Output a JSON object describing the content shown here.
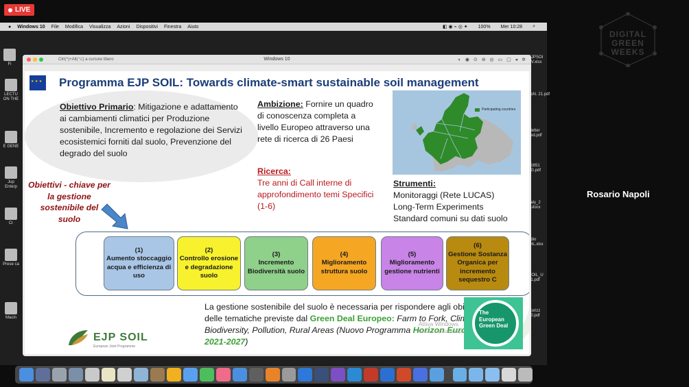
{
  "stream": {
    "live_label": "LIVE",
    "speaker_name": "Rosario Napoli",
    "watermark_lines": [
      "DIGITAL",
      "GREEN",
      "WEEKS"
    ]
  },
  "mac_menubar": {
    "items": [
      "Windows 10",
      "File",
      "Modifica",
      "Visualizza",
      "Azioni",
      "Dispositivi",
      "Finestra",
      "Aiuto"
    ],
    "battery": "100%",
    "clock": "Mer 10:28"
  },
  "desktop": {
    "left_labels": [
      "Fi",
      "LECTU ON THE",
      "E GENE",
      "Jup Enterp",
      "Cr",
      "Prese ca",
      "Macin"
    ],
    "right_labels": [
      "EJPSOI SV.xlsx",
      "doN. 21.pdf",
      "_letter ked.pdf",
      "21651 7G.pdf",
      "Italy_2 4.docx",
      "edio OIL.xlsx",
      "COIL_U 21.pdf",
      "storizz 10.pdf"
    ]
  },
  "vm_window": {
    "title": "Windows 10",
    "hint": "Ctrl(^)+Alt(⌥) a cursore libero"
  },
  "slide": {
    "title": "Programma EJP SOIL: Towards climate-smart sustainable soil management",
    "objective_label": "Obiettivo Primario",
    "objective_text": ": Mitigazione e adattamento ai cambiamenti climatici per Produzione sostenibile, Incremento e regolazione dei Servizi ecosistemici forniti dal suolo, Prevenzione del degrado del suolo",
    "ambition_label": "Ambizione:",
    "ambition_text": " Fornire un quadro di conoscenza completa a livello Europeo attraverso una rete di ricerca di 26 Paesi",
    "research_label": "Ricerca:",
    "research_text": "Tre anni di Call interne di approfondimento temi Specifici (1-6)",
    "map_legend": "Participating countries",
    "tools_label": "Strumenti:",
    "tools": [
      "Monitoraggi (Rete LUCAS)",
      "Long-Term Experiments",
      "Standard comuni su dati suolo"
    ],
    "key_objectives": "Obiettivi - chiave per la gestione sostenibile del suolo",
    "boxes": [
      {
        "num": "(1)",
        "text": "Aumento stoccaggio acqua e efficienza di uso",
        "color": "#a9c6e6"
      },
      {
        "num": "(2)",
        "text": "Controllo erosione e degradazione suolo",
        "color": "#f7f22d"
      },
      {
        "num": "(3)",
        "text": "Incremento Biodiversità suolo",
        "color": "#8fd08a"
      },
      {
        "num": "(4)",
        "text": "Miglioramento struttura suolo",
        "color": "#f5a623"
      },
      {
        "num": "(5)",
        "text": "Miglioramento gestione nutrienti",
        "color": "#c884e6"
      },
      {
        "num": "(6)",
        "text": "Gestione Sostanza Organica per incremento sequestro C",
        "color": "#b88a10"
      }
    ],
    "bottom_text_a": "La gestione sostenibile del suolo è necessaria per rispondere agli obiettivi delle tematiche previste dal ",
    "green_deal": "Green Deal Europeo:",
    "bottom_text_b": " Farm to Fork, Climate, Biodiversity, Pollution, Rural Areas",
    "bottom_text_c": " (Nuovo Programma ",
    "horizon": "Horizon Europe 2021-2027",
    "bottom_text_d": ")",
    "logo_name": "EJP SOIL",
    "logo_sub": "European Joint Programme",
    "green_deal_badge": "The European Green Deal",
    "activate_title": "Attiva Windows",
    "activate_sub": "Passa a Impostazioni per"
  },
  "dock_colors": [
    "#4a8fe0",
    "#5e6f9a",
    "#9aa3ad",
    "#7a8fa8",
    "#c9c9c9",
    "#e9e4c4",
    "#d0d0d0",
    "#8fb5d6",
    "#9a7a50",
    "#f0b020",
    "#5aa0f0",
    "#4cbf5c",
    "#f06a8a",
    "#4a8fe0",
    "#5f5f5f",
    "#e8832a",
    "#9a9a9a",
    "#2d78d8",
    "#3a4f7a",
    "#7c4fc4",
    "#2a8ad4",
    "#c23a2a",
    "#2d6fd0",
    "#d04a2a",
    "#4a6fe0",
    "#5a9fe0",
    "#6aaee6",
    "#7ab6ea",
    "#8abeee",
    "#d8d8d8",
    "#bbbbbb"
  ]
}
